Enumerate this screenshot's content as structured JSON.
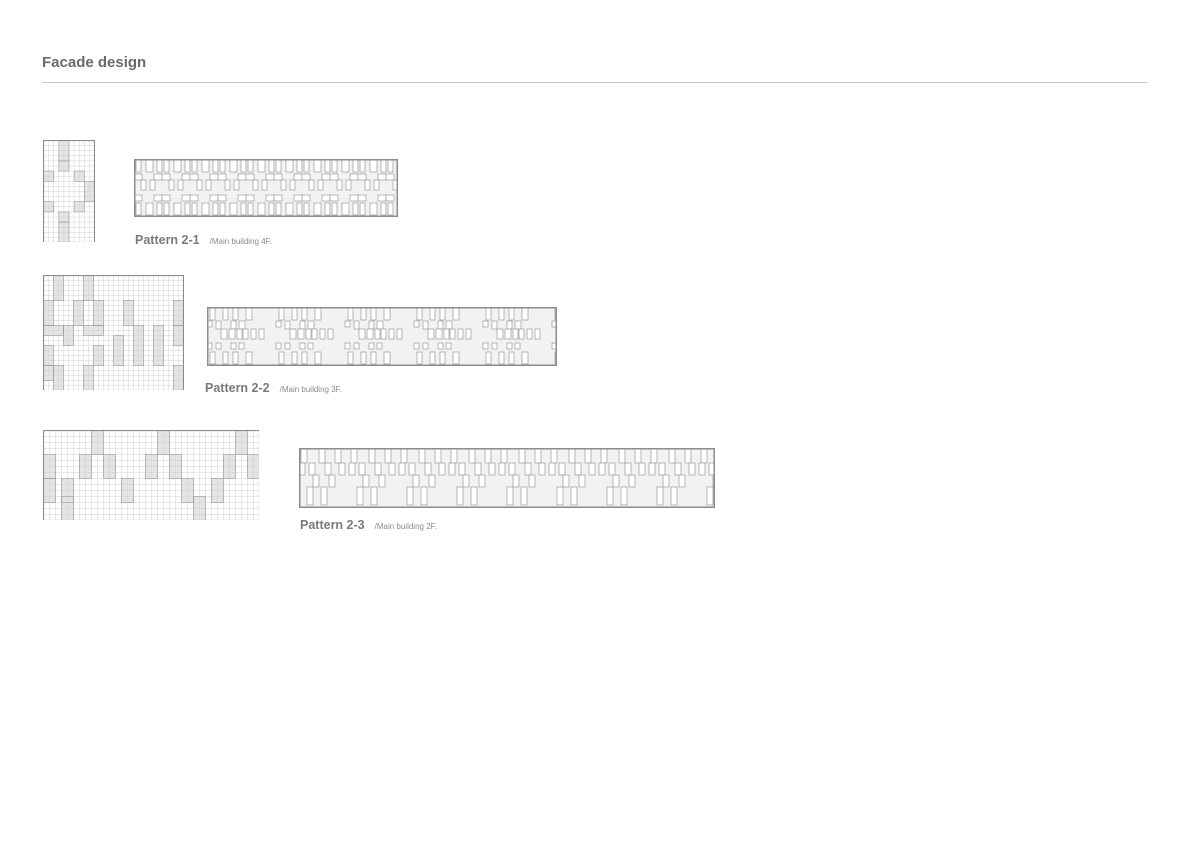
{
  "page": {
    "title": "Facade design"
  },
  "colors": {
    "frame": "#8c8c8c",
    "grid": "#d2d2d2",
    "tile": "#e4e4e4",
    "tile_stroke": "#9a9a9a",
    "strip_fill": "#f2f2f2"
  },
  "patterns": [
    {
      "name": "Pattern 2-1",
      "note": "/Main building 4F."
    },
    {
      "name": "Pattern 2-2",
      "note": "/Main building 3F."
    },
    {
      "name": "Pattern 2-3",
      "note": "/Main building 2F."
    }
  ]
}
